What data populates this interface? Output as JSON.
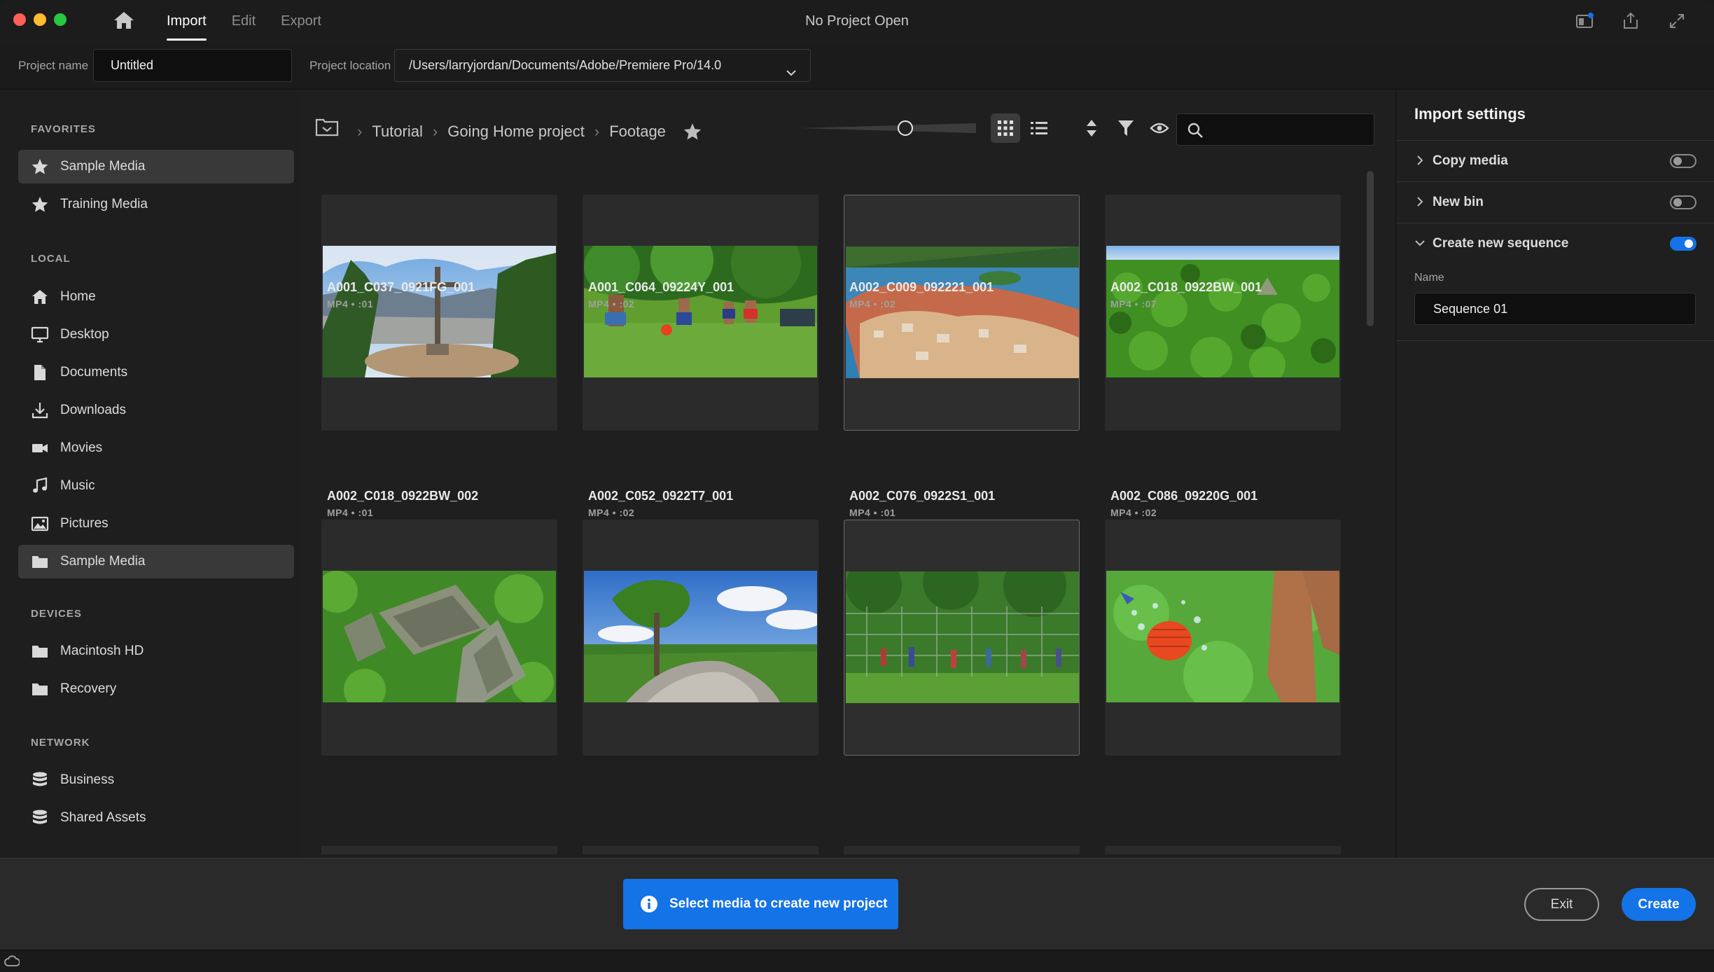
{
  "window": {
    "title": "No Project Open"
  },
  "topnav": {
    "tabs": [
      "Import",
      "Edit",
      "Export"
    ],
    "active": "Import"
  },
  "project": {
    "name_label": "Project name",
    "name_value": "Untitled",
    "location_label": "Project location",
    "location_value": "/Users/larryjordan/Documents/Adobe/Premiere Pro/14.0"
  },
  "sidebar": {
    "favorites_label": "FAVORITES",
    "favorites": [
      {
        "label": "Sample Media",
        "icon": "star-icon",
        "active": true
      },
      {
        "label": "Training Media",
        "icon": "star-icon"
      }
    ],
    "local_label": "LOCAL",
    "local": [
      {
        "label": "Home",
        "icon": "home-icon"
      },
      {
        "label": "Desktop",
        "icon": "desktop-icon"
      },
      {
        "label": "Documents",
        "icon": "document-icon"
      },
      {
        "label": "Downloads",
        "icon": "download-icon"
      },
      {
        "label": "Movies",
        "icon": "movie-icon"
      },
      {
        "label": "Music",
        "icon": "music-icon"
      },
      {
        "label": "Pictures",
        "icon": "picture-icon"
      },
      {
        "label": "Sample Media",
        "icon": "folder-icon",
        "active": true
      }
    ],
    "devices_label": "DEVICES",
    "devices": [
      {
        "label": "Macintosh HD",
        "icon": "folder-icon"
      },
      {
        "label": "Recovery",
        "icon": "folder-icon"
      }
    ],
    "network_label": "NETWORK",
    "network": [
      {
        "label": "Business",
        "icon": "database-icon"
      },
      {
        "label": "Shared Assets",
        "icon": "database-icon"
      }
    ]
  },
  "breadcrumb": [
    "Tutorial",
    "Going Home project",
    "Footage"
  ],
  "toolbar": {
    "thumbnail_size": 0.6,
    "view": "grid"
  },
  "clips": [
    {
      "name": "A001_C037_0921FG_001",
      "meta": "MP4 • :01",
      "thumb": "cross-hill"
    },
    {
      "name": "A001_C064_09224Y_001",
      "meta": "MP4 • :02",
      "thumb": "soccer-kids"
    },
    {
      "name": "A002_C009_092221_001",
      "meta": "MP4 • :02",
      "thumb": "island-town",
      "selected": true
    },
    {
      "name": "A002_C018_0922BW_001",
      "meta": "MP4 • :07",
      "thumb": "jungle-ruins"
    },
    {
      "name": "A002_C018_0922BW_002",
      "meta": "MP4 • :01",
      "thumb": "temple-aerial"
    },
    {
      "name": "A002_C052_0922T7_001",
      "meta": "MP4 • :02",
      "thumb": "tree-rock"
    },
    {
      "name": "A002_C076_0922S1_001",
      "meta": "MP4 • :01",
      "thumb": "soccer-field",
      "selected": true
    },
    {
      "name": "A002_C086_09220G_001",
      "meta": "MP4 • :02",
      "thumb": "ball-splash"
    }
  ],
  "import_settings": {
    "title": "Import settings",
    "copy_media": "Copy media",
    "new_bin": "New bin",
    "create_sequence": "Create new sequence",
    "name_label": "Name",
    "sequence_name": "Sequence 01",
    "copy_media_on": false,
    "new_bin_on": false,
    "create_sequence_on": true
  },
  "footer": {
    "message": "Select media to create new project",
    "exit_label": "Exit",
    "create_label": "Create"
  },
  "colors": {
    "accent": "#1473e6"
  }
}
